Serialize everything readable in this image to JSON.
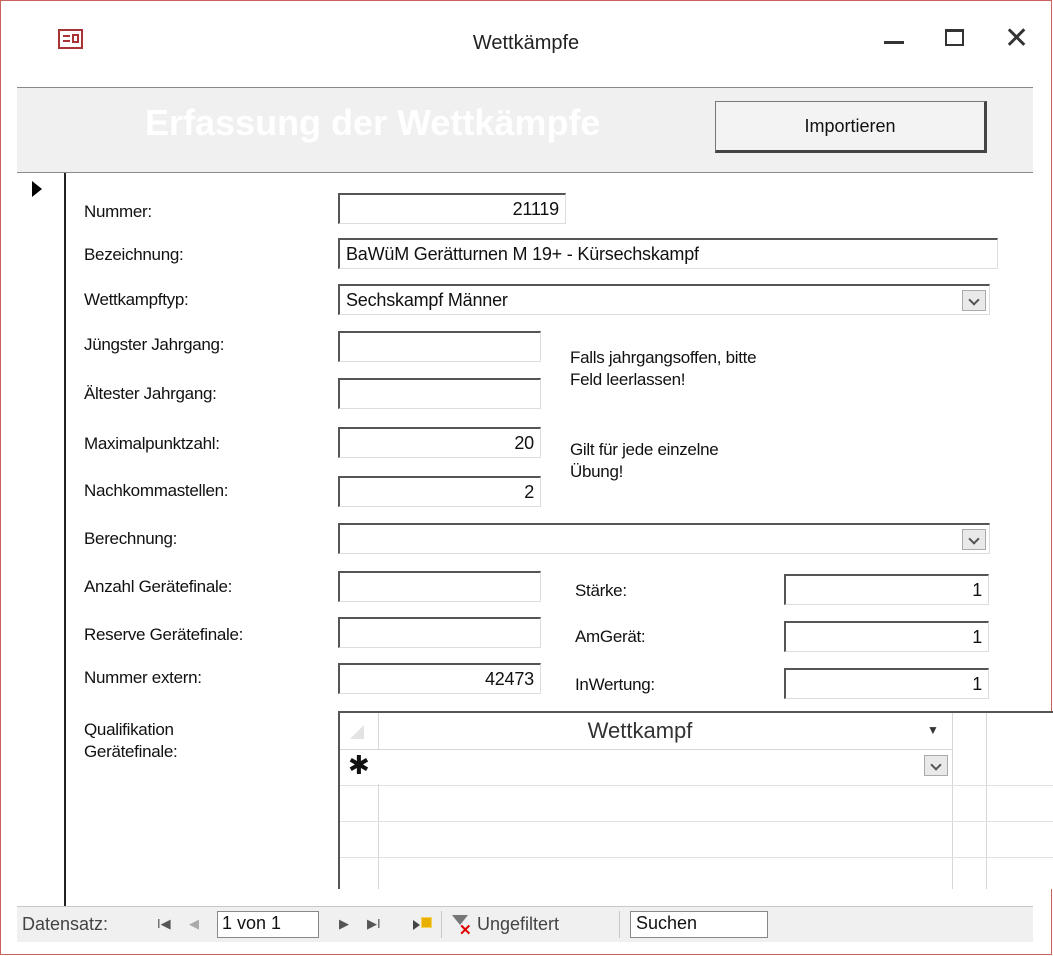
{
  "window": {
    "title": "Wettkämpfe"
  },
  "header": {
    "title": "Erfassung der Wettkämpfe",
    "import_button": "Importieren"
  },
  "form": {
    "nummer_label": "Nummer:",
    "nummer_value": "21119",
    "bezeichnung_label": "Bezeichnung:",
    "bezeichnung_value": "BaWüM Gerätturnen M 19+ - Kürsechskampf",
    "wettkampftyp_label": "Wettkampftyp:",
    "wettkampftyp_value": "Sechskampf Männer",
    "juengster_label": "Jüngster Jahrgang:",
    "juengster_value": "",
    "aeltester_label": "Ältester Jahrgang:",
    "aeltester_value": "",
    "jahrgang_note": "Falls jahrgangsoffen, bitte\nFeld leerlassen!",
    "maximalpunktzahl_label": "Maximalpunktzahl:",
    "maximalpunktzahl_value": "20",
    "nachkommastellen_label": "Nachkommastellen:",
    "nachkommastellen_value": "2",
    "punkte_note": "Gilt für jede einzelne\nÜbung!",
    "berechnung_label": "Berechnung:",
    "berechnung_value": "",
    "anzahl_label": "Anzahl Gerätefinale:",
    "anzahl_value": "",
    "reserve_label": "Reserve Gerätefinale:",
    "reserve_value": "",
    "nummer_extern_label": "Nummer extern:",
    "nummer_extern_value": "42473",
    "staerke_label": "Stärke:",
    "staerke_value": "1",
    "amgeraet_label": "AmGerät:",
    "amgeraet_value": "1",
    "inwertung_label": "InWertung:",
    "inwertung_value": "1",
    "qualifikation_label": "Qualifikation\nGerätefinale:"
  },
  "subform": {
    "column_title": "Wettkampf",
    "new_row_marker": "✱",
    "rows": [
      ""
    ]
  },
  "navigation": {
    "label": "Datensatz:",
    "first": "I◀",
    "prev": "◀",
    "record": "1 von 1",
    "next": "▶",
    "last": "▶I",
    "filter_label": "Ungefiltert",
    "search_value": "Suchen"
  }
}
